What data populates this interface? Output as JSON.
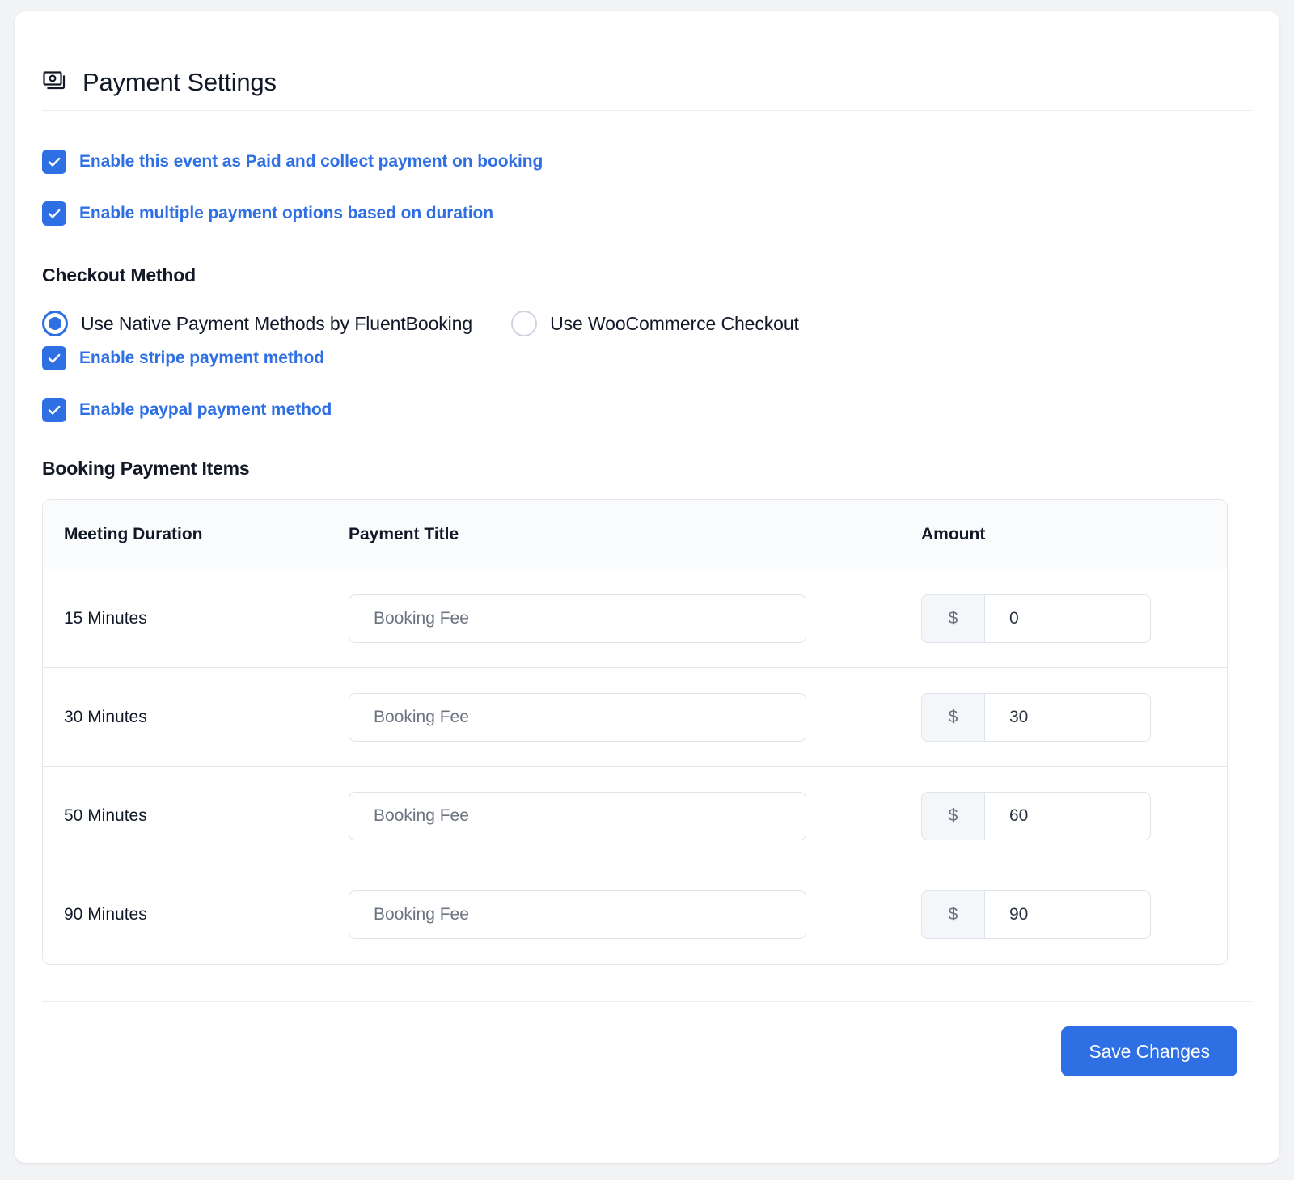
{
  "header": {
    "icon": "payment-cards-icon",
    "title": "Payment Settings"
  },
  "toggles": [
    {
      "id": "enable-paid-event",
      "label": "Enable this event as Paid and collect payment on booking",
      "checked": true
    },
    {
      "id": "enable-multiple-payment-options",
      "label": "Enable multiple payment options based on duration",
      "checked": true
    }
  ],
  "checkout_method": {
    "heading": "Checkout Method",
    "options": [
      {
        "id": "native",
        "label": "Use Native Payment Methods by FluentBooking",
        "selected": true
      },
      {
        "id": "woocommerce",
        "label": "Use WooCommerce Checkout",
        "selected": false
      }
    ]
  },
  "payment_methods": [
    {
      "id": "enable-stripe",
      "label": "Enable stripe payment method",
      "checked": true
    },
    {
      "id": "enable-paypal",
      "label": "Enable paypal payment method",
      "checked": true
    }
  ],
  "booking_payment_items": {
    "heading": "Booking Payment Items",
    "columns": {
      "duration": "Meeting Duration",
      "title": "Payment Title",
      "amount": "Amount"
    },
    "currency_symbol": "$",
    "title_placeholder": "Booking Fee",
    "rows": [
      {
        "duration": "15 Minutes",
        "title": "Booking Fee",
        "amount": "0"
      },
      {
        "duration": "30 Minutes",
        "title": "Booking Fee",
        "amount": "30"
      },
      {
        "duration": "50 Minutes",
        "title": "Booking Fee",
        "amount": "60"
      },
      {
        "duration": "90 Minutes",
        "title": "Booking Fee",
        "amount": "90"
      }
    ]
  },
  "footer": {
    "save_label": "Save Changes"
  },
  "colors": {
    "accent": "#2f6fe4",
    "page_background": "#f2f3f5",
    "card_background": "#ffffff",
    "heading_text": "#121826",
    "muted_text": "#6b7280",
    "border": "#e5e7ec"
  }
}
